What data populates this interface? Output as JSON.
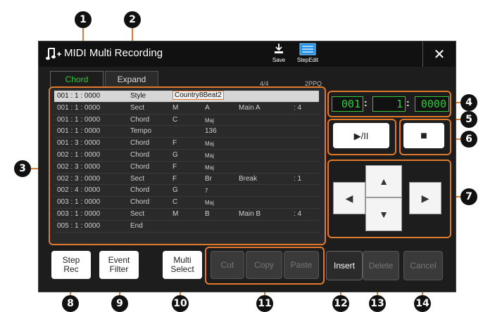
{
  "window": {
    "title": "MIDI Multi Recording",
    "save_label": "Save",
    "stepedit_label": "StepEdit"
  },
  "tabs": [
    {
      "label": "Chord",
      "active": true
    },
    {
      "label": "Expand",
      "active": false
    }
  ],
  "meter": {
    "time_signature": "4/4",
    "ppq": "2PPQ"
  },
  "events": [
    {
      "pos": "001 : 1 : 0000",
      "type": "Style",
      "v1": "Country8Beat2",
      "v2": "",
      "v3": "",
      "v4": "",
      "selected": true
    },
    {
      "pos": "001 : 1 : 0000",
      "type": "Sect",
      "v1": "M",
      "v2": "A",
      "v3": "Main A",
      "v4": ": 4",
      "selected": false
    },
    {
      "pos": "001 : 1 : 0000",
      "type": "Chord",
      "v1": "C",
      "v2": "Maj",
      "v3": "",
      "v4": "",
      "selected": false
    },
    {
      "pos": "001 : 1 : 0000",
      "type": "Tempo",
      "v1": "",
      "v2": "136",
      "v3": "",
      "v4": "",
      "selected": false
    },
    {
      "pos": "001 : 3 : 0000",
      "type": "Chord",
      "v1": "F",
      "v2": "Maj",
      "v3": "",
      "v4": "",
      "selected": false
    },
    {
      "pos": "002 : 1 : 0000",
      "type": "Chord",
      "v1": "G",
      "v2": "Maj",
      "v3": "",
      "v4": "",
      "selected": false
    },
    {
      "pos": "002 : 3 : 0000",
      "type": "Chord",
      "v1": "F",
      "v2": "Maj",
      "v3": "",
      "v4": "",
      "selected": false
    },
    {
      "pos": "002 : 3 : 0000",
      "type": "Sect",
      "v1": "F",
      "v2": "Br",
      "v3": "Break",
      "v4": ": 1",
      "selected": false
    },
    {
      "pos": "002 : 4 : 0000",
      "type": "Chord",
      "v1": "G",
      "v2": "7",
      "v3": "",
      "v4": "",
      "selected": false
    },
    {
      "pos": "003 : 1 : 0000",
      "type": "Chord",
      "v1": "C",
      "v2": "Maj",
      "v3": "",
      "v4": "",
      "selected": false
    },
    {
      "pos": "003 : 1 : 0000",
      "type": "Sect",
      "v1": "M",
      "v2": "B",
      "v3": "Main B",
      "v4": ": 4",
      "selected": false
    },
    {
      "pos": "005 : 1 : 0000",
      "type": "End",
      "v1": "",
      "v2": "",
      "v3": "",
      "v4": "",
      "selected": false
    }
  ],
  "position": {
    "measure": "001",
    "beat": "1",
    "clock": "0000"
  },
  "transport": {
    "play_pause_label": "▶/II",
    "stop_label": "■"
  },
  "buttons": {
    "step_rec": "Step\nRec",
    "event_filter": "Event\nFilter",
    "multi_select": "Multi\nSelect",
    "cut": "Cut",
    "copy": "Copy",
    "paste": "Paste",
    "insert": "Insert",
    "delete": "Delete",
    "cancel": "Cancel"
  },
  "callouts": [
    "1",
    "2",
    "3",
    "4",
    "5",
    "6",
    "7",
    "8",
    "9",
    "10",
    "11",
    "12",
    "13",
    "14"
  ],
  "colors": {
    "accent": "#e07a2c",
    "green": "#2ecc3a",
    "background": "#1d1d1d"
  }
}
